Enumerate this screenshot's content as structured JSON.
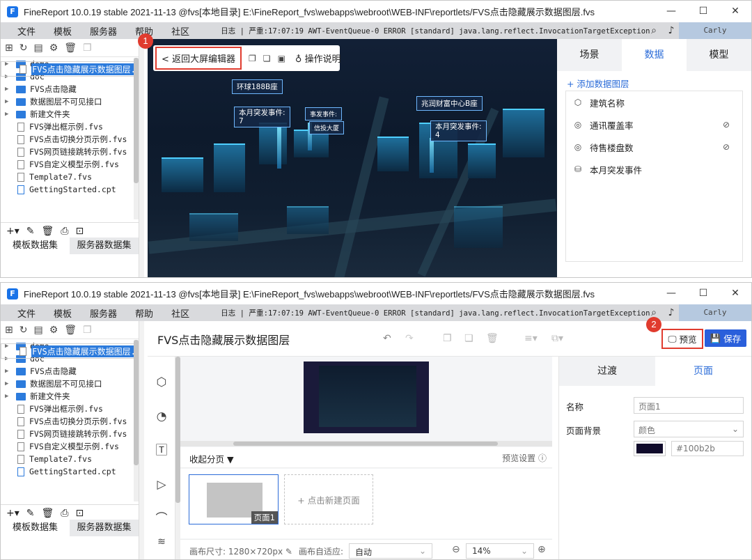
{
  "windows": [
    {
      "title": "FineReport 10.0.19 stable 2021-11-13 @fvs[本地目录]    E:\\FineReport_fvs\\webapps\\webroot\\WEB-INF\\reportlets/FVS点击隐藏展示数据图层.fvs",
      "menu": [
        "文件",
        "模板",
        "服务器",
        "帮助",
        "社区"
      ],
      "log": "日志 | 严重:17:07:19 AWT-EventQueue-0 ERROR [standard] java.lang.reflect.InvocationTargetException",
      "user": "Carly"
    },
    {
      "title": "FineReport 10.0.19 stable 2021-11-13 @fvs[本地目录]    E:\\FineReport_fvs\\webapps\\webroot\\WEB-INF\\reportlets/FVS点击隐藏展示数据图层.fvs",
      "menu": [
        "文件",
        "模板",
        "服务器",
        "帮助",
        "社区"
      ],
      "log": "日志 | 严重:17:07:19 AWT-EventQueue-0 ERROR [standard] java.lang.reflect.InvocationTargetException",
      "user": "Carly"
    }
  ],
  "tree": {
    "folders": [
      "demo",
      "doc",
      "FVS点击隐藏",
      "数据图层不可见接口",
      "新建文件夹"
    ],
    "files": [
      "FVS弹出框示例.fvs",
      "FVS点击切换分页示例.fvs",
      "FVS点击隐藏展示数据图层.f",
      "FVS网页链接跳转示例.fvs",
      "FVS自定义模型示例.fvs",
      "Template7.fvs",
      "GettingStarted.cpt"
    ]
  },
  "dataset_tabs": [
    "模板数据集",
    "服务器数据集"
  ],
  "w1": {
    "back_label": "< 返回大屏编辑器",
    "help_label": "操作说明",
    "badge": "1",
    "scene_labels": [
      "环球188B座",
      "本月突发事件:",
      "7",
      "兆润财富中心B座",
      "本月突发事件:",
      "4",
      "事发事件:",
      "信投大厦"
    ],
    "tabs": [
      "场景",
      "数据",
      "模型"
    ],
    "add_layer": "+ 添加数据图层",
    "layers": [
      "建筑名称",
      "通讯覆盖率",
      "待售楼盘数",
      "本月突发事件"
    ]
  },
  "w2": {
    "page_title": "FVS点击隐藏展示数据图层",
    "preview_label": "预览",
    "save_label": "保存",
    "badge": "2",
    "collapse_label": "收起分页 ▼",
    "preview_settings": "预览设置",
    "page_thumb_label": "页面1",
    "new_page_label": "+ 点击新建页面",
    "canvas_size_label": "画布尺寸: 1280×720px",
    "canvas_adapt_label": "画布自适应:",
    "adapt_value": "自动",
    "zoom_value": "14%",
    "tabs": [
      "过渡",
      "页面"
    ],
    "name_label": "名称",
    "name_value": "页面1",
    "bg_label": "页面背景",
    "bg_value": "颜色",
    "bg_color": "#100b2b"
  }
}
